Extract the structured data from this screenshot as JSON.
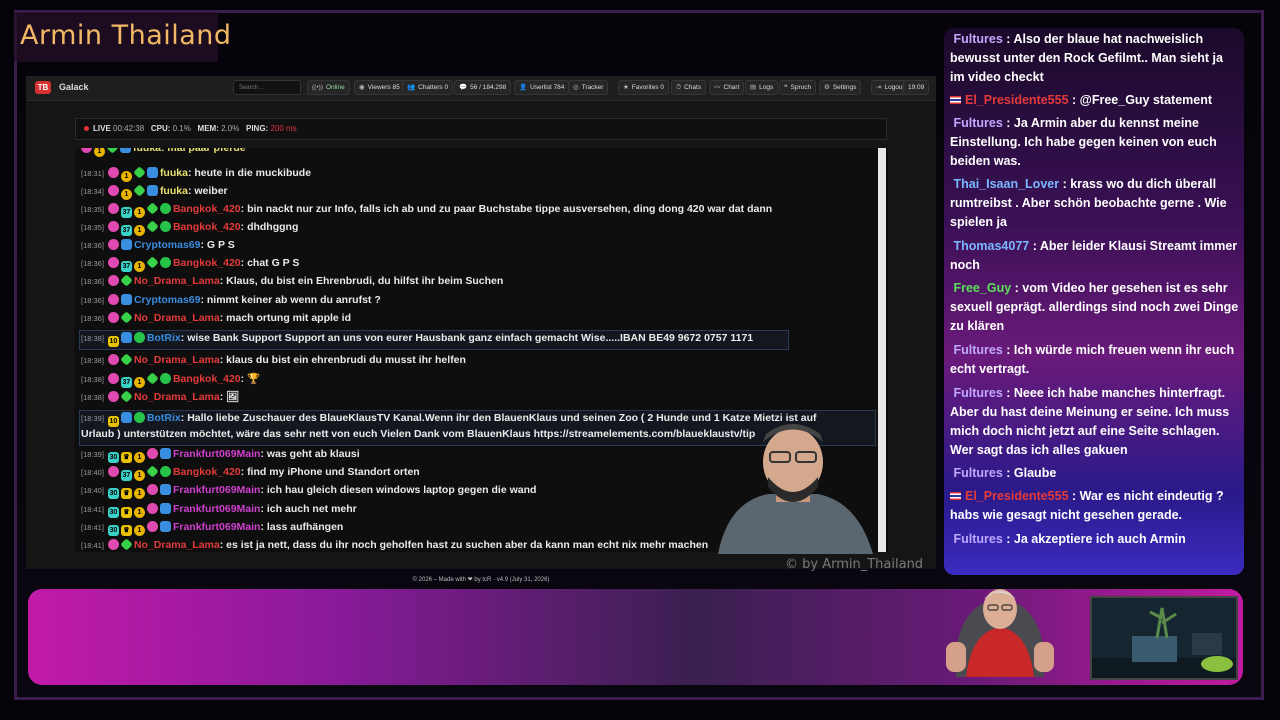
{
  "stream": {
    "title": "Armin Thailand",
    "watermark": "© by Armin_Thailand"
  },
  "app": {
    "name": "Galack",
    "search_placeholder": "Search...",
    "nav": [
      {
        "label": "Online",
        "icon": "signal-icon"
      },
      {
        "label": "Viewers 85",
        "icon": "eye-icon"
      },
      {
        "label": "Chatters 0",
        "icon": "users-icon"
      },
      {
        "label": "56 / 184.298",
        "icon": "chat-icon"
      },
      {
        "label": "Userlist 784",
        "icon": "user-icon"
      },
      {
        "label": "Tracker",
        "icon": "target-icon"
      },
      {
        "label": "Favorites 0",
        "icon": "star-icon"
      },
      {
        "label": "Chats",
        "icon": "clock-icon"
      },
      {
        "label": "Chart",
        "icon": "chart-icon"
      },
      {
        "label": "Logs",
        "icon": "file-icon"
      },
      {
        "label": "Spruch",
        "icon": "quote-icon"
      },
      {
        "label": "Settings",
        "icon": "gear-icon"
      },
      {
        "label": "Logout",
        "icon": "logout-icon"
      },
      {
        "label": "19:09",
        "icon": ""
      }
    ],
    "status": {
      "live": "LIVE",
      "live_time": "00:42:38",
      "cpu_label": "CPU:",
      "cpu": "0.1%",
      "mem_label": "MEM:",
      "mem": "2.0%",
      "ping_label": "PING:",
      "ping": "200 ms"
    },
    "footer": "© 2026 – Made with ❤ by tcR · v4.9 (July 31, 2026)",
    "messages": [
      {
        "time": "[18:31]",
        "user": "fuuka",
        "color": "#e8e070",
        "text": "heute in die muckibude"
      },
      {
        "time": "[18:34]",
        "user": "fuuka",
        "color": "#e8e070",
        "text": "weiber"
      },
      {
        "time": "[18:35]",
        "user": "Bangkok_420",
        "color": "#e43a3a",
        "text": "bin nackt nur zur Info, falls ich ab und zu paar Buchstabe tippe ausversehen, ding dong 420 war dat dann"
      },
      {
        "time": "[18:35]",
        "user": "Bangkok_420",
        "color": "#e43a3a",
        "text": "dhdhggng"
      },
      {
        "time": "[18:36]",
        "user": "Cryptomas69",
        "color": "#3a8ee0",
        "text": "G P S"
      },
      {
        "time": "[18:36]",
        "user": "Bangkok_420",
        "color": "#e43a3a",
        "text": "chat G P S"
      },
      {
        "time": "[18:36]",
        "user": "No_Drama_Lama",
        "color": "#e43a3a",
        "text": "Klaus, du bist ein Ehrenbrudi, du hilfst ihr beim Suchen"
      },
      {
        "time": "[18:36]",
        "user": "Cryptomas69",
        "color": "#3a8ee0",
        "text": "nimmt keiner ab wenn du anrufst ?"
      },
      {
        "time": "[18:36]",
        "user": "No_Drama_Lama",
        "color": "#e43a3a",
        "text": "mach ortung mit apple id"
      },
      {
        "time": "[18:38]",
        "user": "BotRix",
        "color": "#3a8ee0",
        "text": "wise Bank Support Support an uns von eurer Hausbank ganz einfach gemacht Wise.....IBAN BE49 9672 0757 1171"
      },
      {
        "time": "[18:38]",
        "user": "No_Drama_Lama",
        "color": "#e43a3a",
        "text": "klaus du bist ein ehrenbrudi du musst ihr helfen"
      },
      {
        "time": "[18:38]",
        "user": "Bangkok_420",
        "color": "#e43a3a",
        "text": "🏆"
      },
      {
        "time": "[18:38]",
        "user": "No_Drama_Lama",
        "color": "#e43a3a",
        "text": "🖼"
      },
      {
        "time": "[18:39]",
        "user": "BotRix",
        "color": "#3a8ee0",
        "text": "Hallo liebe Zuschauer des BlaueKlausTV Kanal.Wenn ihr den BlauenKlaus und seinen Zoo ( 2 Hunde und 1 Katze Mietzi ist auf",
        "text2": "Urlaub ) unterstützen möchtet, wäre das sehr nett von euch Vielen Dank vom BlauenKlaus https://streamelements.com/blaueklaustv/tip"
      },
      {
        "time": "[18:39]",
        "user": "Frankfurt069Main",
        "color": "#d040d0",
        "text": "was geht ab klausi"
      },
      {
        "time": "[18:40]",
        "user": "Bangkok_420",
        "color": "#e43a3a",
        "text": "find my iPhone und Standort orten"
      },
      {
        "time": "[18:40]",
        "user": "Frankfurt069Main",
        "color": "#d040d0",
        "text": "ich hau gleich diesen windows laptop gegen die wand"
      },
      {
        "time": "[18:41]",
        "user": "Frankfurt069Main",
        "color": "#d040d0",
        "text": "ich auch net mehr"
      },
      {
        "time": "[18:41]",
        "user": "Frankfurt069Main",
        "color": "#d040d0",
        "text": "lass aufhängen"
      },
      {
        "time": "[18:41]",
        "user": "No_Drama_Lama",
        "color": "#e43a3a",
        "text": "es ist ja nett, dass du ihr noch geholfen hast zu suchen aber da kann man echt nix mehr machen"
      }
    ],
    "cut_top_line": "fuuka: mal paar pferde"
  },
  "side_chat": [
    {
      "user": "Fultures",
      "color": "#c0a8ff",
      "text": "Also der blaue hat nachweislich bewusst unter den Rock Gefilmt.. Man sieht ja im video checkt"
    },
    {
      "user": "El_Presidente555",
      "color": "#e43a3a",
      "flag": true,
      "text": "@Free_Guy statement"
    },
    {
      "user": "Fultures",
      "color": "#c0a8ff",
      "text": "Ja Armin aber du kennst meine Einstellung. Ich habe gegen keinen von euch beiden was."
    },
    {
      "user": "Thai_Isaan_Lover",
      "color": "#7ab8ff",
      "text": "krass wo du dich überall rumtreibst . Aber schön beobachte gerne . Wie spielen ja"
    },
    {
      "user": "Thomas4077",
      "color": "#7ab8ff",
      "text": "Aber leider Klausi Streamt immer noch"
    },
    {
      "user": "Free_Guy",
      "color": "#5ae05a",
      "text": "vom Video her gesehen ist es sehr sexuell geprägt. allerdings sind noch zwei Dinge zu klären"
    },
    {
      "user": "Fultures",
      "color": "#c0a8ff",
      "text": "Ich würde mich freuen wenn ihr euch echt vertragt."
    },
    {
      "user": "Fultures",
      "color": "#c0a8ff",
      "text": "Neee ich habe manches hinterfragt. Aber du hast deine Meinung er seine. Ich muss mich doch nicht jetzt auf eine Seite schlagen. Wer sagt das ich alles gakuen"
    },
    {
      "user": "Fultures",
      "color": "#c0a8ff",
      "text": "Glaube"
    },
    {
      "user": "El_Presidente555",
      "color": "#e43a3a",
      "flag": true,
      "text": "War es nicht eindeutig ? habs wie gesagt nicht gesehen gerade."
    },
    {
      "user": "Fultures",
      "color": "#c0a8ff",
      "text": "Ja akzeptiere ich auch Armin"
    }
  ]
}
